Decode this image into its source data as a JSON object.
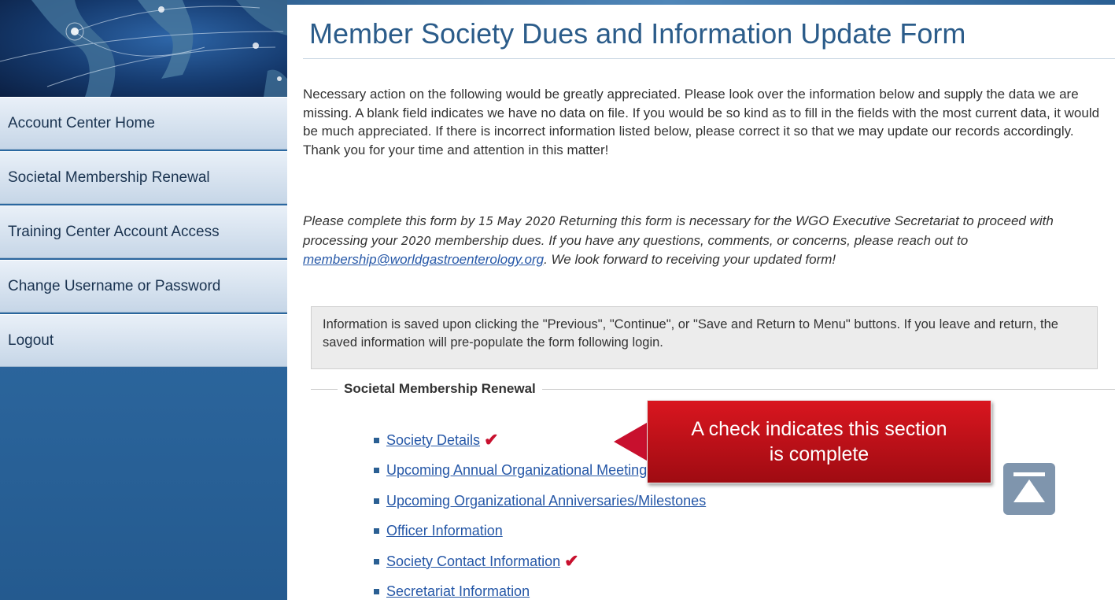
{
  "title": "Member Society Dues and Information Update Form",
  "sidebar": {
    "items": [
      {
        "label": "Account Center Home"
      },
      {
        "label": "Societal Membership Renewal"
      },
      {
        "label": "Training Center Account Access"
      },
      {
        "label": "Change Username or Password"
      },
      {
        "label": "Logout"
      }
    ]
  },
  "intro": "Necessary action on the following would be greatly appreciated. Please look over the information below and supply the data we are missing. A blank field indicates we have no data on file. If you would be so kind as to fill in the fields with the most current data, it would be much appreciated. If there is incorrect information listed below, please correct it so that we may update our records accordingly. Thank you for your time and attention in this matter!",
  "notice": {
    "part1": "Please complete this form by ",
    "date": "15 May 2020",
    "part2": " Returning this form is necessary for the WGO Executive Secretariat to proceed with processing your ",
    "year": "2020",
    "part3": " membership dues. If you have any questions, comments, or concerns, please reach out to ",
    "email": "membership@worldgastroenterology.org",
    "part4": ". We look forward to receiving your updated form!"
  },
  "info_box": "Information is saved upon clicking the \"Previous\", \"Continue\", or \"Save and Return to Menu\" buttons. If you leave and return, the saved information will pre-populate the form following login.",
  "section": {
    "legend": "Societal Membership Renewal",
    "items": [
      {
        "label": "Society Details",
        "check": "✔"
      },
      {
        "label": "Upcoming Annual Organizational Meeting",
        "check": ""
      },
      {
        "label": "Upcoming Organizational Anniversaries/Milestones",
        "check": ""
      },
      {
        "label": "Officer Information",
        "check": ""
      },
      {
        "label": "Society Contact Information",
        "check": "✔"
      },
      {
        "label": "Secretariat Information",
        "check": ""
      }
    ]
  },
  "callout": "A check indicates this section is complete",
  "colors": {
    "accent_red": "#c8102e",
    "link": "#2557a7",
    "title": "#2b5c8a",
    "sidebar": "#2a6aa5"
  },
  "icons": {
    "scroll_top": "triangle-up-with-bar-icon",
    "check": "red-checkmark-icon",
    "callout_arrow": "left-arrow-icon",
    "banner": "world-map-banner"
  }
}
